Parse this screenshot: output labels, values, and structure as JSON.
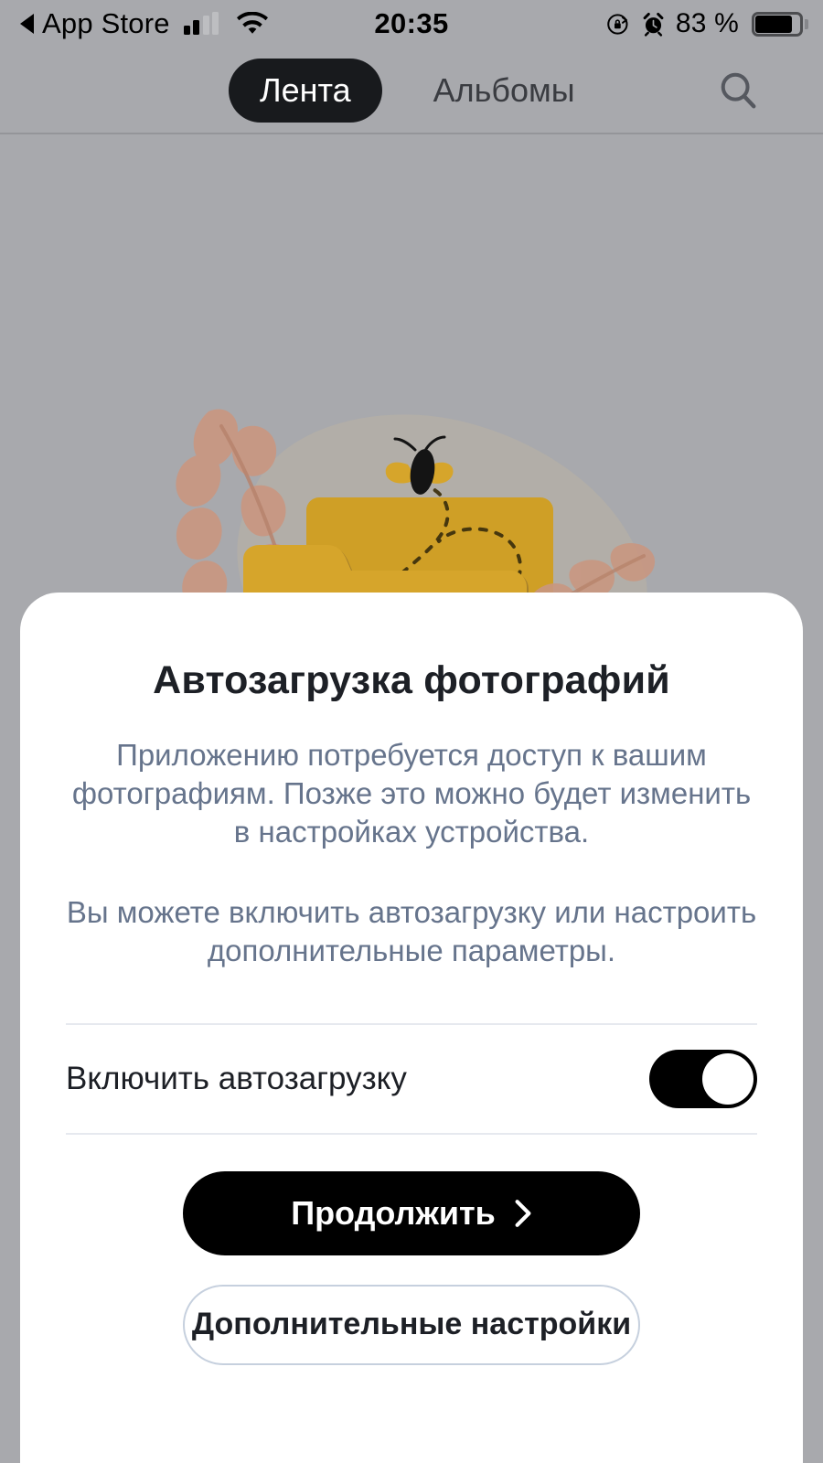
{
  "status_bar": {
    "back_label": "App Store",
    "back_icon": "back-triangle-icon",
    "signal_icon": "cellular-signal-icon",
    "wifi_icon": "wifi-icon",
    "time": "20:35",
    "rotation_lock_icon": "rotation-lock-icon",
    "alarm_icon": "alarm-clock-icon",
    "battery_percent": "83 %",
    "battery_icon": "battery-icon"
  },
  "nav": {
    "tabs": [
      {
        "label": "Лента",
        "active": true
      },
      {
        "label": "Альбомы",
        "active": false
      }
    ],
    "search_icon": "search-icon"
  },
  "illustration": {
    "name": "folder-with-bee-illustration",
    "colors": {
      "folder_front": "#d6a52b",
      "folder_back": "#cf9f26",
      "folder_shadow": "#a8812a",
      "leaf": "#c99781",
      "blob": "#bdb5a6",
      "bee_body": "#141414",
      "bee_wing": "#d6a52b",
      "background": "#a8a9ad"
    }
  },
  "sheet": {
    "title": "Автозагрузка фотографий",
    "paragraphs": [
      "Приложению потребуется доступ к вашим фотографиям. Позже это можно будет изменить в настройках устройства.",
      "Вы можете включить автозагрузку или настроить дополнительные параметры."
    ],
    "toggle": {
      "label": "Включить автозагрузку",
      "state": "on"
    },
    "primary_button": {
      "label": "Продолжить",
      "icon": "chevron-right-icon"
    },
    "secondary_button": {
      "label": "Дополнительные настройки"
    }
  },
  "colors": {
    "status_bar_bg": "#a8a9ad",
    "nav_bg": "#a8a9ad",
    "sheet_bg": "#ffffff",
    "accent_dark": "#000000",
    "body_text": "#66748c",
    "title_text": "#1d2026",
    "divider": "#e6e9ef",
    "secondary_border": "#c6d0de"
  }
}
